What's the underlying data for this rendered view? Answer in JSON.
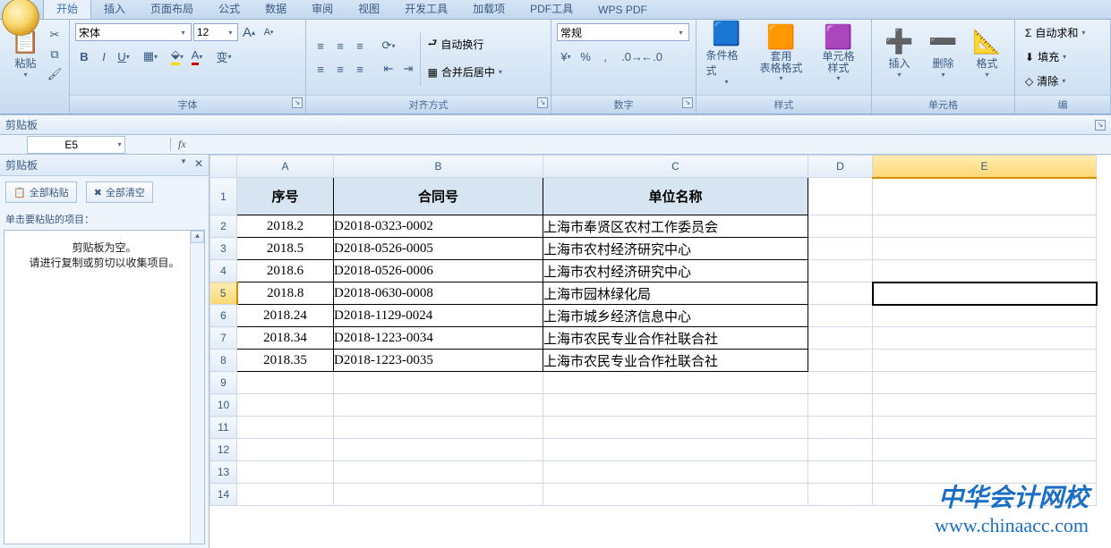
{
  "tabs": [
    "开始",
    "插入",
    "页面布局",
    "公式",
    "数据",
    "审阅",
    "视图",
    "开发工具",
    "加载项",
    "PDF工具",
    "WPS PDF"
  ],
  "active_tab": 0,
  "clipboard_group": {
    "label": "剪贴板",
    "paste": "粘贴"
  },
  "font_group": {
    "label": "字体",
    "font_name": "宋体",
    "font_size": "12",
    "bold": "B",
    "italic": "I",
    "underline": "U",
    "grow": "A",
    "shrink": "A"
  },
  "align_group": {
    "label": "对齐方式",
    "wrap": "自动换行",
    "merge": "合并后居中"
  },
  "number_group": {
    "label": "数字",
    "format": "常规"
  },
  "styles_group": {
    "label": "样式",
    "cond": "条件格式",
    "table": "套用\n表格格式",
    "cell": "单元格\n样式"
  },
  "cells_group": {
    "label": "单元格",
    "insert": "插入",
    "delete": "删除",
    "format": "格式"
  },
  "editing_group": {
    "sum": "自动求和",
    "fill": "填充",
    "clear": "清除"
  },
  "clip_pane": {
    "title": "剪贴板",
    "paste_all": "全部粘贴",
    "clear_all": "全部清空",
    "caption": "单击要粘贴的项目：",
    "empty1": "剪贴板为空。",
    "empty2": "请进行复制或剪切以收集项目。"
  },
  "name_box": "E5",
  "columns": [
    "A",
    "B",
    "C",
    "D",
    "E"
  ],
  "header_row": {
    "a": "序号",
    "b": "合同号",
    "c": "单位名称"
  },
  "rows": [
    {
      "a": "2018.2",
      "b": "D2018-0323-0002",
      "c": "上海市奉贤区农村工作委员会"
    },
    {
      "a": "2018.5",
      "b": "D2018-0526-0005",
      "c": "上海市农村经济研究中心"
    },
    {
      "a": "2018.6",
      "b": "D2018-0526-0006",
      "c": "上海市农村经济研究中心"
    },
    {
      "a": "2018.8",
      "b": "D2018-0630-0008",
      "c": "上海市园林绿化局"
    },
    {
      "a": "2018.24",
      "b": "D2018-1129-0024",
      "c": "上海市城乡经济信息中心"
    },
    {
      "a": "2018.34",
      "b": "D2018-1223-0034",
      "c": "上海市农民专业合作社联合社"
    },
    {
      "a": "2018.35",
      "b": "D2018-1223-0035",
      "c": "上海市农民专业合作社联合社"
    }
  ],
  "selected_row": 5,
  "watermark1": "中华会计网校",
  "watermark2": "www.chinaacc.com"
}
